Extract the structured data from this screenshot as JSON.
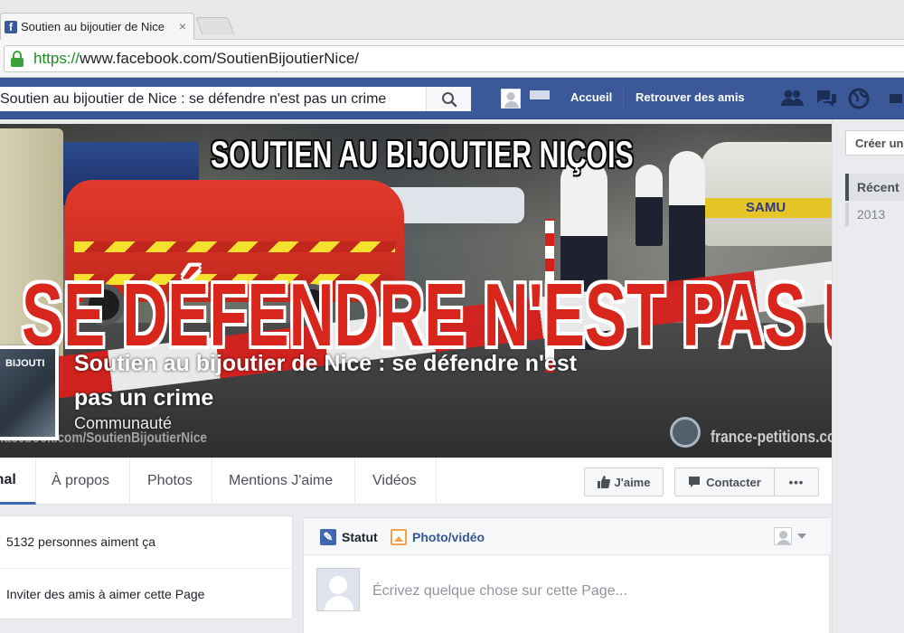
{
  "browser": {
    "tab_title": "Soutien au bijoutier de Nice",
    "tab_close": "×",
    "url_scheme": "https://",
    "url_rest": "www.facebook.com/SoutienBijoutierNice/"
  },
  "fb": {
    "search_value": "Soutien au bijoutier de Nice : se défendre n'est pas un crime",
    "nav_home": "Accueil",
    "nav_find_friends": "Retrouver des amis",
    "brand_color": "#3b5998"
  },
  "cover": {
    "headline_top": "SOUTIEN AU BIJOUTIER NIÇOIS",
    "headline_main": "SE DÉFENDRE N'EST PAS UN CRIME !",
    "samu_label": "SAMU",
    "watermark_url": "facebook.com/SoutienBijoutierNice",
    "watermark_site": "france-petitions.com",
    "profile_mini_text": "BIJOUTI"
  },
  "page": {
    "name": "Soutien au bijoutier de Nice : se défendre n'est pas un crime",
    "category": "Communauté"
  },
  "tabs": [
    {
      "label": "Journal"
    },
    {
      "label": "À propos"
    },
    {
      "label": "Photos"
    },
    {
      "label": "Mentions J'aime"
    },
    {
      "label": "Vidéos"
    }
  ],
  "actions": {
    "like": "J'aime",
    "contact": "Contacter",
    "more": "•••"
  },
  "left_card": {
    "likes": "5132 personnes aiment ça",
    "invite": "Inviter des amis à aimer cette Page"
  },
  "composer": {
    "status": "Statut",
    "photo_video": "Photo/vidéo",
    "placeholder": "Écrivez quelque chose sur cette Page..."
  },
  "right": {
    "create": "Créer une Page",
    "recent": "Récent",
    "year": "2013"
  }
}
